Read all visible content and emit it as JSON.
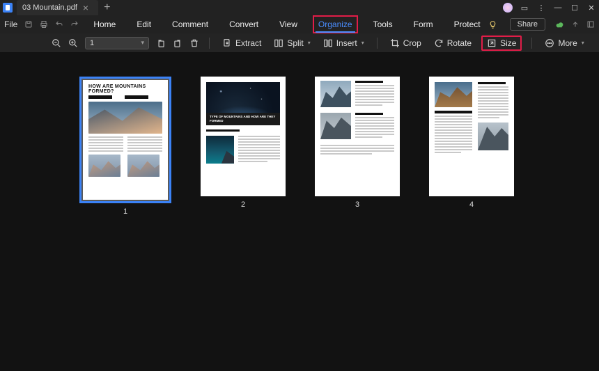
{
  "titlebar": {
    "filename": "03 Mountain.pdf"
  },
  "menubar": {
    "file": "File",
    "items": [
      "Home",
      "Edit",
      "Comment",
      "Convert",
      "View",
      "Organize",
      "Tools",
      "Form",
      "Protect"
    ],
    "active_index": 5,
    "share": "Share"
  },
  "toolbar": {
    "page_value": "1",
    "extract": "Extract",
    "split": "Split",
    "insert": "Insert",
    "crop": "Crop",
    "rotate": "Rotate",
    "size": "Size",
    "more": "More"
  },
  "pages": {
    "p1": {
      "title": "HOW ARE MOUNTAINS FORMED?",
      "num": "1"
    },
    "p2": {
      "band": "TYPE OF MOUNTAINS AND HOW ARE THEY FORMED",
      "num": "2"
    },
    "p3": {
      "num": "3"
    },
    "p4": {
      "num": "4"
    }
  }
}
